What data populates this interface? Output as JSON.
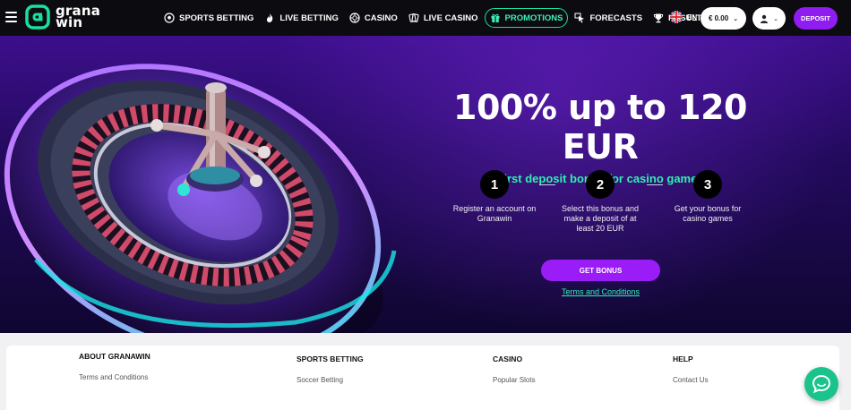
{
  "brand": {
    "line1": "grana",
    "line2": "win",
    "accent": "#18e0a0"
  },
  "nav": {
    "items": [
      {
        "label": "SPORTS BETTING",
        "icon": "soccer-ball-icon",
        "active": false
      },
      {
        "label": "LIVE BETTING",
        "icon": "flame-icon",
        "active": false
      },
      {
        "label": "CASINO",
        "icon": "casino-chip-icon",
        "active": false
      },
      {
        "label": "LIVE CASINO",
        "icon": "cards-icon",
        "active": false
      },
      {
        "label": "PROMOTIONS",
        "icon": "gift-icon",
        "active": true
      },
      {
        "label": "FORECASTS",
        "icon": "cursor-icon",
        "active": false
      },
      {
        "label": "RESULTS",
        "icon": "trophy-icon",
        "active": false
      }
    ],
    "language": "EN",
    "balance": "€ 0.00",
    "deposit_label": "DEPOSIT"
  },
  "hero": {
    "title": "100% up to 120 EUR",
    "subtitle": "First deposit bonus for casino games",
    "steps": [
      {
        "number": "1",
        "text": "Register an account on Granawin"
      },
      {
        "number": "2",
        "text": "Select this bonus and make a deposit of at least 20 EUR"
      },
      {
        "number": "3",
        "text": "Get your bonus for casino games"
      }
    ],
    "cta_label": "GET BONUS",
    "terms_label": "Terms and Conditions",
    "button_color": "#9a1df7",
    "subtitle_color": "#2ef0b0"
  },
  "footer": {
    "columns": [
      {
        "title": "ABOUT GRANAWIN",
        "link": "Terms and Conditions"
      },
      {
        "title": "SPORTS BETTING",
        "link": "Soccer Betting"
      },
      {
        "title": "CASINO",
        "link": "Popular Slots"
      },
      {
        "title": "HELP",
        "link": "Contact Us"
      }
    ]
  }
}
